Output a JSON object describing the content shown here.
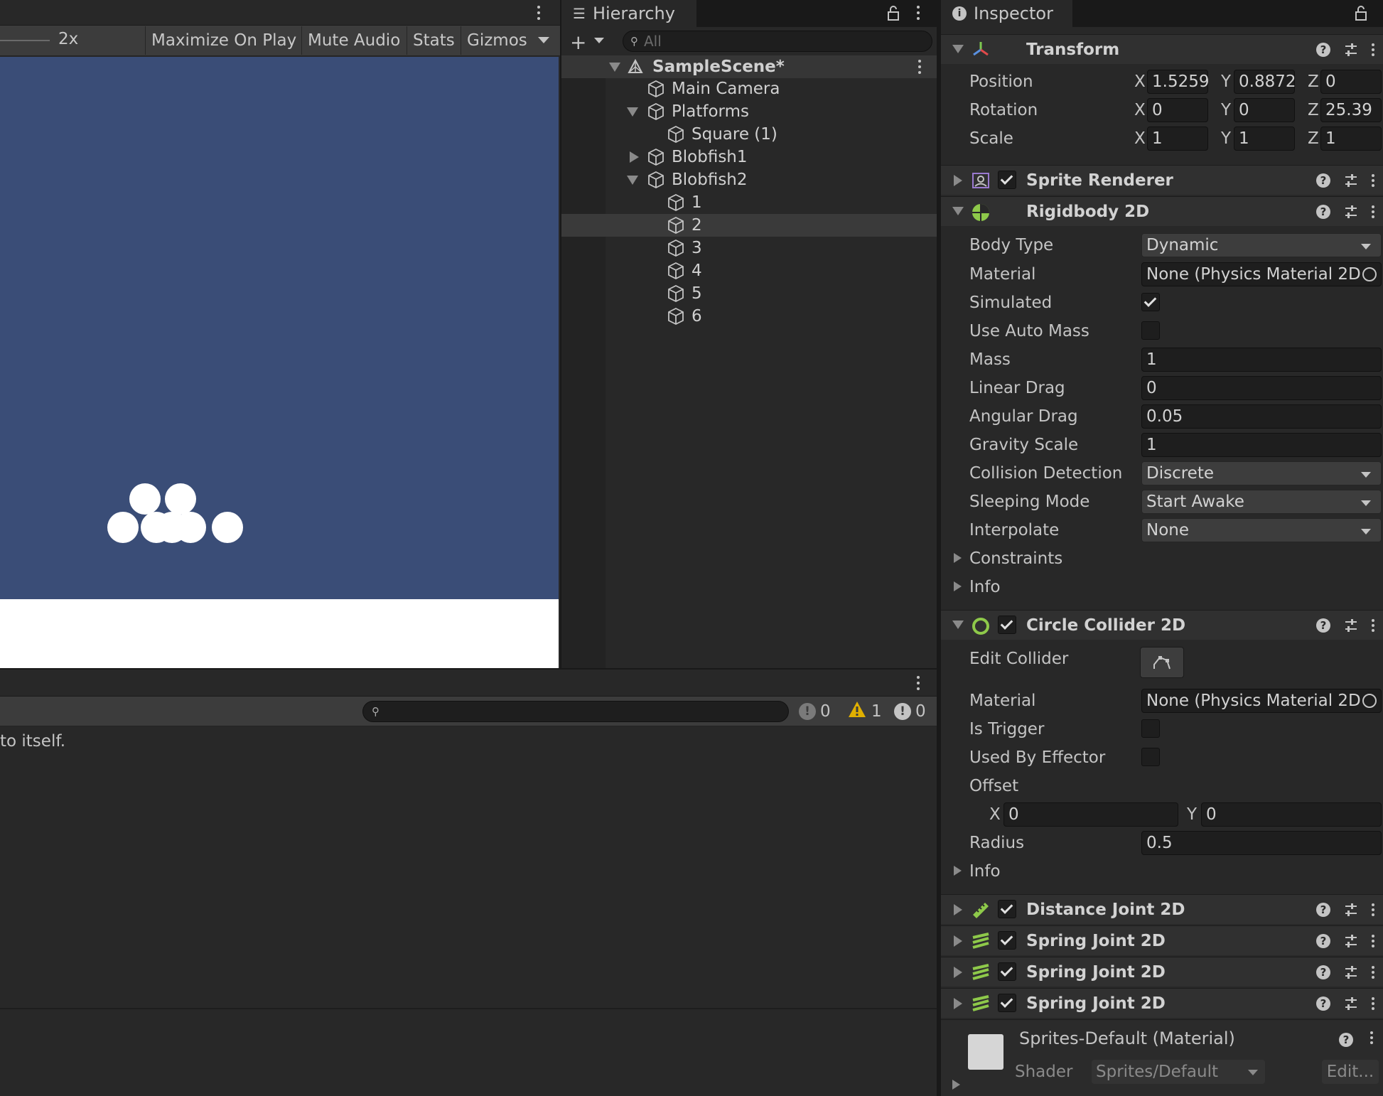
{
  "game": {
    "zoom_label": "2x",
    "toolbar": [
      "Maximize On Play",
      "Mute Audio",
      "Stats",
      "Gizmos"
    ]
  },
  "hierarchy": {
    "tab_label": "Hierarchy",
    "search_placeholder": "All",
    "scene_name": "SampleScene*",
    "items": [
      "Main Camera",
      "Platforms",
      "Square (1)",
      "Blobfish1",
      "Blobfish2",
      "1",
      "2",
      "3",
      "4",
      "5",
      "6"
    ]
  },
  "console": {
    "message": "to itself.",
    "counts": {
      "errors": "0",
      "warnings": "1",
      "info": "0"
    }
  },
  "inspector": {
    "tab_label": "Inspector",
    "transform": {
      "title": "Transform",
      "labels": [
        "Position",
        "Rotation",
        "Scale"
      ],
      "axes": [
        "X",
        "Y",
        "Z"
      ],
      "position": [
        "1.5259",
        "0.8872",
        "0"
      ],
      "rotation": [
        "0",
        "0",
        "25.39"
      ],
      "scale": [
        "1",
        "1",
        "1"
      ]
    },
    "sprite_renderer": {
      "title": "Sprite Renderer"
    },
    "rigidbody": {
      "title": "Rigidbody 2D",
      "labels": {
        "body_type": "Body Type",
        "material": "Material",
        "simulated": "Simulated",
        "use_auto_mass": "Use Auto Mass",
        "mass": "Mass",
        "linear_drag": "Linear Drag",
        "angular_drag": "Angular Drag",
        "gravity_scale": "Gravity Scale",
        "collision_detection": "Collision Detection",
        "sleeping_mode": "Sleeping Mode",
        "interpolate": "Interpolate",
        "constraints": "Constraints",
        "info": "Info"
      },
      "body_type": "Dynamic",
      "material": "None (Physics Material 2D",
      "simulated": true,
      "use_auto_mass": false,
      "mass": "1",
      "linear_drag": "0",
      "angular_drag": "0.05",
      "gravity_scale": "1",
      "collision_detection": "Discrete",
      "sleeping_mode": "Start Awake",
      "interpolate": "None"
    },
    "circle_collider": {
      "title": "Circle Collider 2D",
      "labels": {
        "edit_collider": "Edit Collider",
        "material": "Material",
        "is_trigger": "Is Trigger",
        "used_by_effector": "Used By Effector",
        "offset": "Offset",
        "radius": "Radius",
        "info": "Info"
      },
      "material": "None (Physics Material 2D",
      "is_trigger": false,
      "used_by_effector": false,
      "offset_x": "0",
      "offset_y": "0",
      "radius": "0.5"
    },
    "joints": [
      "Distance Joint 2D",
      "Spring Joint 2D",
      "Spring Joint 2D",
      "Spring Joint 2D"
    ],
    "material_preview": {
      "name": "Sprites-Default (Material)",
      "shader_label": "Shader",
      "shader_value": "Sprites/Default",
      "edit_label": "Edit..."
    }
  },
  "colors": {
    "game_bg": "#3a4d77",
    "accent_green": "#8ec94a"
  }
}
